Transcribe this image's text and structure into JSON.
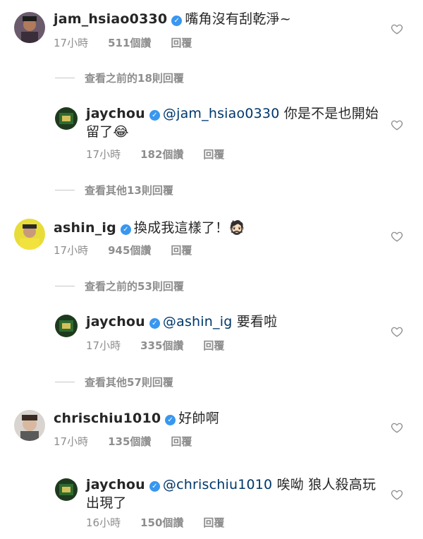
{
  "comments": [
    {
      "username": "jam_hsiao0330",
      "verified": true,
      "text": "嘴角沒有刮乾淨~",
      "time": "17小時",
      "likes": "511個讚",
      "reply": "回覆"
    },
    {
      "username": "jaychou",
      "verified": true,
      "mention": "@jam_hsiao0330",
      "text_line1": "你是不是也開始",
      "text_line2": "留了",
      "emoji": "😂",
      "time": "17小時",
      "likes": "182個讚",
      "reply": "回覆"
    },
    {
      "username": "ashin_ig",
      "verified": true,
      "text": "換成我這樣了！",
      "emoji": "🧔🏻",
      "time": "17小時",
      "likes": "945個讚",
      "reply": "回覆"
    },
    {
      "username": "jaychou",
      "verified": true,
      "mention": "@ashin_ig",
      "text": "要看啦",
      "time": "17小時",
      "likes": "335個讚",
      "reply": "回覆"
    },
    {
      "username": "chrischiu1010",
      "verified": true,
      "text": "好帥啊",
      "time": "17小時",
      "likes": "135個讚",
      "reply": "回覆"
    },
    {
      "username": "jaychou",
      "verified": true,
      "mention": "@chrischiu1010",
      "text_line1": "唉呦 狼人殺高玩",
      "text_line2": "出現了",
      "time": "16小時",
      "likes": "150個讚",
      "reply": "回覆"
    }
  ],
  "view_more": [
    "查看之前的18則回覆",
    "查看其他13則回覆",
    "查看之前的53則回覆",
    "查看其他57則回覆"
  ],
  "icons": {
    "heart": "heart-outline-icon",
    "verified": "verified-badge-icon"
  },
  "colors": {
    "verified": "#3897f0",
    "mention": "#00376b",
    "meta": "#8e8e8e"
  }
}
